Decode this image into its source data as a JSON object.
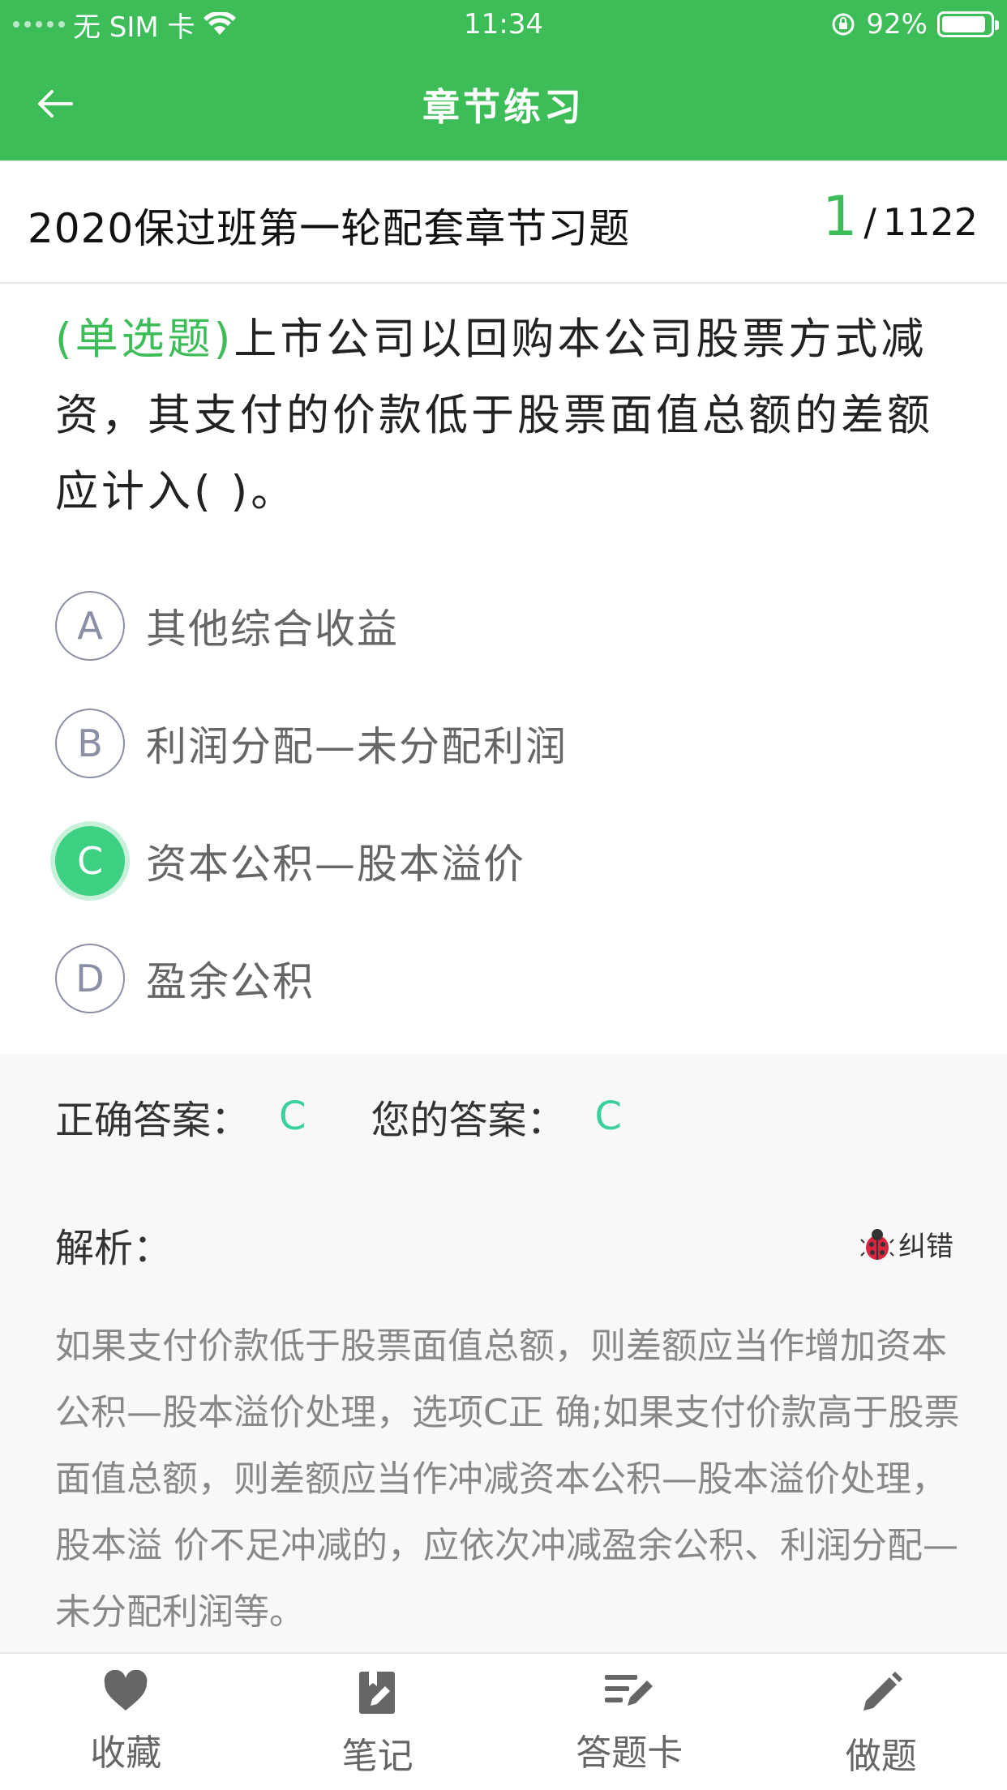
{
  "status_bar": {
    "carrier": "无 SIM 卡",
    "time": "11:34",
    "battery": "92%",
    "battery_level": 0.92
  },
  "nav": {
    "title": "章节练习"
  },
  "header": {
    "chapter_title": "2020保过班第一轮配套章节习题",
    "current": "1",
    "separator": "/",
    "total": "1122"
  },
  "question": {
    "type": "(单选题)",
    "text": "上市公司以回购本公司股票方式减资，其支付的价款低于股票面值总额的差额应计入( )。"
  },
  "options": [
    {
      "letter": "A",
      "text": "其他综合收益",
      "selected": false
    },
    {
      "letter": "B",
      "text": "利润分配—未分配利润",
      "selected": false
    },
    {
      "letter": "C",
      "text": "资本公积—股本溢价",
      "selected": true
    },
    {
      "letter": "D",
      "text": "盈余公积",
      "selected": false
    }
  ],
  "answer": {
    "correct_label": "正确答案：",
    "correct_value": "C",
    "yours_label": "您的答案：",
    "yours_value": "C"
  },
  "analysis": {
    "label": "解析：",
    "report_error": "纠错",
    "text": "如果支付价款低于股票面值总额，则差额应当作增加资本公积—股本溢价处理，选项C正 确;如果支付价款高于股票面值总额，则差额应当作冲减资本公积—股本溢价处理，股本溢 价不足冲减的，应依次冲减盈余公积、利润分配—未分配利润等。"
  },
  "tabs": [
    {
      "label": "收藏",
      "icon": "heart-icon"
    },
    {
      "label": "笔记",
      "icon": "note-icon"
    },
    {
      "label": "答题卡",
      "icon": "answer-sheet-icon"
    },
    {
      "label": "做题",
      "icon": "pencil-icon"
    }
  ],
  "colors": {
    "brand_green": "#3dbd58",
    "selected_green": "#3cd083",
    "answer_teal": "#3cd0a0"
  }
}
